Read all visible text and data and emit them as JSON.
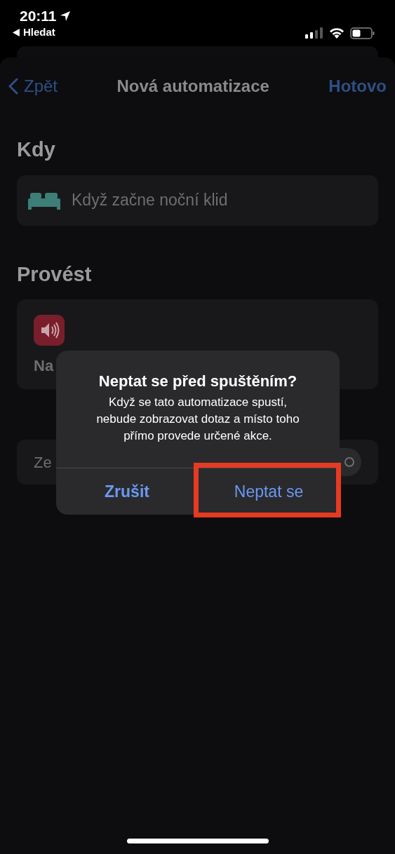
{
  "status_bar": {
    "time": "20:11",
    "back_app": "Hledat"
  },
  "nav": {
    "back": "Zpět",
    "title": "Nová automatizace",
    "done": "Hotovo"
  },
  "sections": [
    {
      "heading": "Kdy",
      "kind": "trigger",
      "label": "Když začne noční klid"
    },
    {
      "heading": "Provést",
      "kind": "action",
      "label": "Na"
    }
  ],
  "setting": {
    "label": "Ze",
    "on": false
  },
  "alert": {
    "title": "Neptat se před spuštěním?",
    "message": "Když se tato automatizace spustí, nebude zobrazovat dotaz a místo toho přímo provede určené akce.",
    "buttons": [
      {
        "label": "Zrušit",
        "highlighted": false
      },
      {
        "label": "Neptat se",
        "highlighted": true
      }
    ]
  }
}
